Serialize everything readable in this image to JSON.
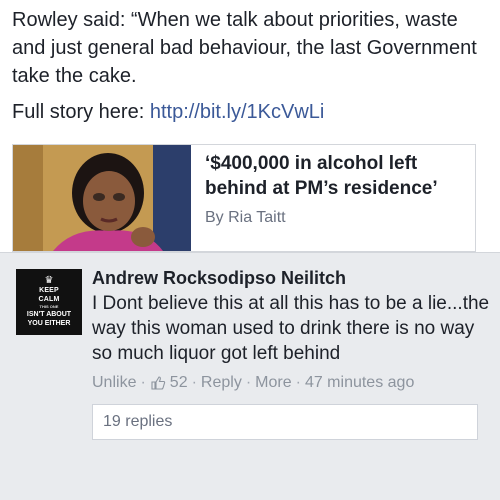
{
  "post": {
    "text_line": "Rowley said: “When we talk about priorities, waste and just general bad behaviour, the last Government take the cake.",
    "story_label": "Full story here: ",
    "story_link": "http://bit.ly/1KcVwLi"
  },
  "link_card": {
    "title": "‘$400,000 in alcohol left behind at PM’s residence’",
    "author": "By Ria Taitt",
    "thumbnail_icon": "news-photo-woman"
  },
  "comment": {
    "avatar_lines": [
      "KEEP",
      "CALM",
      "THIS ONE",
      "ISN'T ABOUT",
      "YOU EITHER"
    ],
    "author": "Andrew Rocksodipso Neilitch",
    "text": "I Dont believe this at all this has to be a lie...the way this woman used to drink there is no way so much liquor got left behind",
    "actions": {
      "unlike": "Unlike",
      "separator": "·",
      "likes": "52",
      "reply": "Reply",
      "more": "More",
      "time": "47 minutes ago"
    },
    "replies": "19 replies"
  },
  "colors": {
    "link": "#3b5998",
    "muted": "#8d949e",
    "comment_bg": "#e9ebee"
  }
}
